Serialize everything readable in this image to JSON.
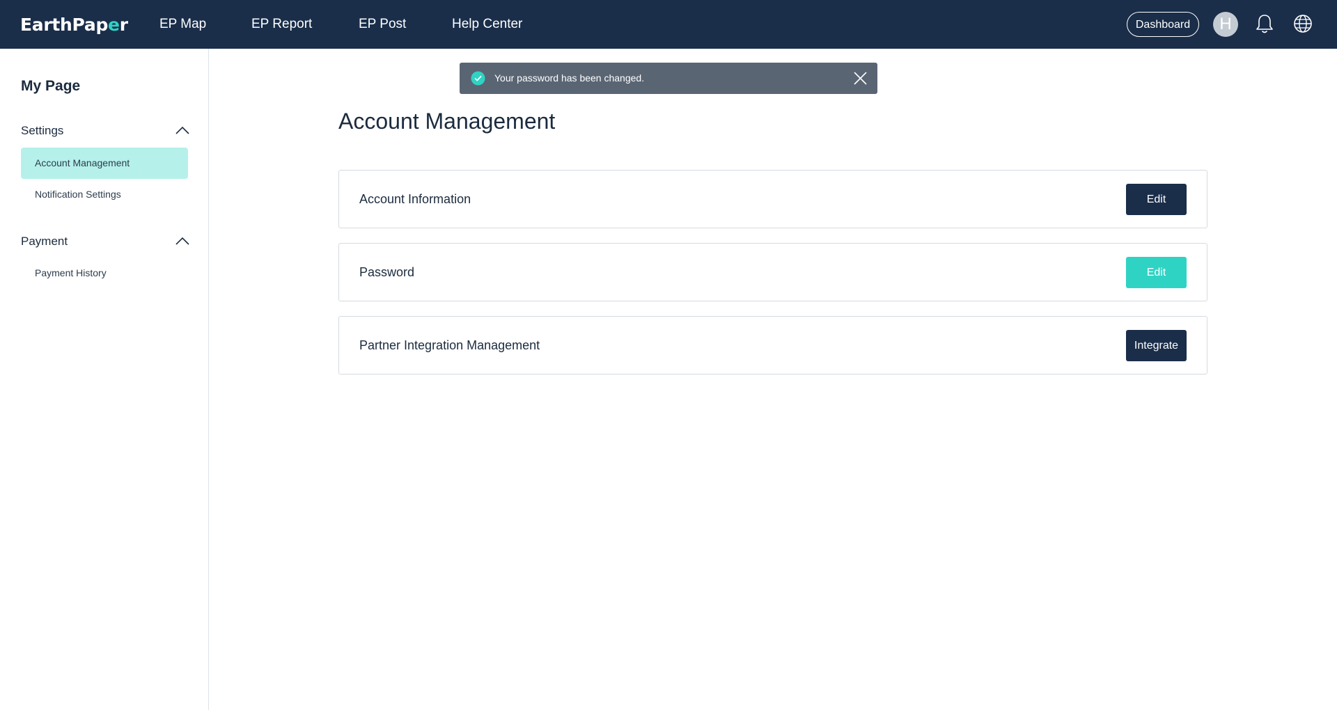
{
  "colors": {
    "nav_bg": "#1a2e4a",
    "accent": "#2fd3c4",
    "active_item_bg": "#b5f1ea",
    "toast_bg": "#5a6574"
  },
  "header": {
    "logo": {
      "text_before": "EarthPap",
      "text_accent": "e",
      "text_after": "r"
    },
    "nav": [
      {
        "label": "EP Map"
      },
      {
        "label": "EP Report"
      },
      {
        "label": "EP Post"
      },
      {
        "label": "Help Center"
      }
    ],
    "dashboard_label": "Dashboard",
    "avatar_initial": "H",
    "icons": [
      "bell-icon",
      "globe-icon"
    ]
  },
  "sidebar": {
    "title": "My Page",
    "sections": [
      {
        "label": "Settings",
        "icon": "chevron-up-icon",
        "items": [
          {
            "label": "Account Management",
            "active": true
          },
          {
            "label": "Notification Settings",
            "active": false
          }
        ]
      },
      {
        "label": "Payment",
        "icon": "chevron-up-icon",
        "items": [
          {
            "label": "Payment History",
            "active": false
          }
        ]
      }
    ]
  },
  "toast": {
    "message": "Your password has been changed.",
    "icons": [
      "check-circle-icon",
      "close-icon"
    ]
  },
  "main": {
    "title": "Account Management",
    "cards": [
      {
        "label": "Account Information",
        "button": "Edit"
      },
      {
        "label": "Password",
        "button": "Edit"
      },
      {
        "label": "Partner Integration Management",
        "button": "Integrate"
      }
    ]
  }
}
